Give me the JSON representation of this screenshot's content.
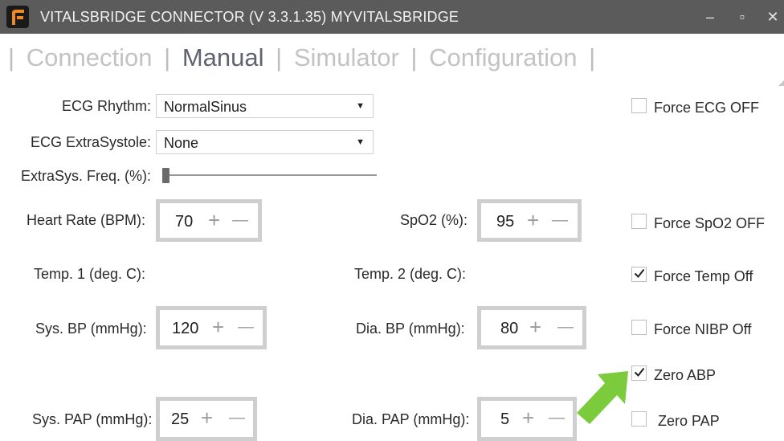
{
  "window": {
    "title": "VITALSBRIDGE CONNECTOR (V 3.3.1.35)  MYVITALSBRIDGE",
    "minimize_glyph": "–",
    "maximize_glyph": "▫",
    "close_glyph": "✕"
  },
  "tabs": [
    {
      "label": "Connection"
    },
    {
      "label": "Manual"
    },
    {
      "label": "Simulator"
    },
    {
      "label": "Configuration"
    }
  ],
  "tab_separator": "|",
  "active_tab": "Manual",
  "ecg": {
    "rhythm_label": "ECG Rhythm:",
    "rhythm_value": "NormalSinus",
    "extrasystole_label": "ECG ExtraSystole:",
    "extrasystole_value": "None",
    "extrasys_freq_label": "ExtraSys. Freq. (%):",
    "extrasys_freq_level": 0
  },
  "vitals": {
    "heart_rate_label": "Heart Rate (BPM):",
    "heart_rate_value": "70",
    "spo2_label": "SpO2 (%):",
    "spo2_value": "95",
    "temp1_label": "Temp. 1 (deg. C):",
    "temp2_label": "Temp. 2 (deg. C):",
    "sys_bp_label": "Sys. BP (mmHg):",
    "sys_bp_value": "120",
    "dia_bp_label": "Dia. BP (mmHg):",
    "dia_bp_value": "80",
    "sys_pap_label": "Sys. PAP (mmHg):",
    "sys_pap_value": "25",
    "dia_pap_label": "Dia. PAP (mmHg):",
    "dia_pap_value": "5"
  },
  "stepper_glyphs": {
    "plus": "+",
    "minus": "—"
  },
  "checkboxes": {
    "force_ecg_off": {
      "label": "Force ECG OFF",
      "checked": false
    },
    "force_spo2_off": {
      "label": "Force SpO2 OFF",
      "checked": false
    },
    "force_temp_off": {
      "label": "Force Temp Off",
      "checked": true
    },
    "force_nibp_off": {
      "label": "Force NIBP Off",
      "checked": false
    },
    "zero_abp": {
      "label": "Zero ABP",
      "checked": true
    },
    "zero_pap": {
      "label": "Zero PAP",
      "checked": false
    }
  },
  "colors": {
    "titlebar": "#5b5b5b",
    "active_tab": "#5f6470",
    "inactive_tab": "#c3c3c3",
    "annotation_arrow": "#7ccb3c"
  },
  "icons": {
    "app_logo": "app-logo-icon",
    "dropdown": "chevron-down-icon",
    "checkmark": "checkmark-icon",
    "annotation": "arrow-pointer-icon"
  }
}
